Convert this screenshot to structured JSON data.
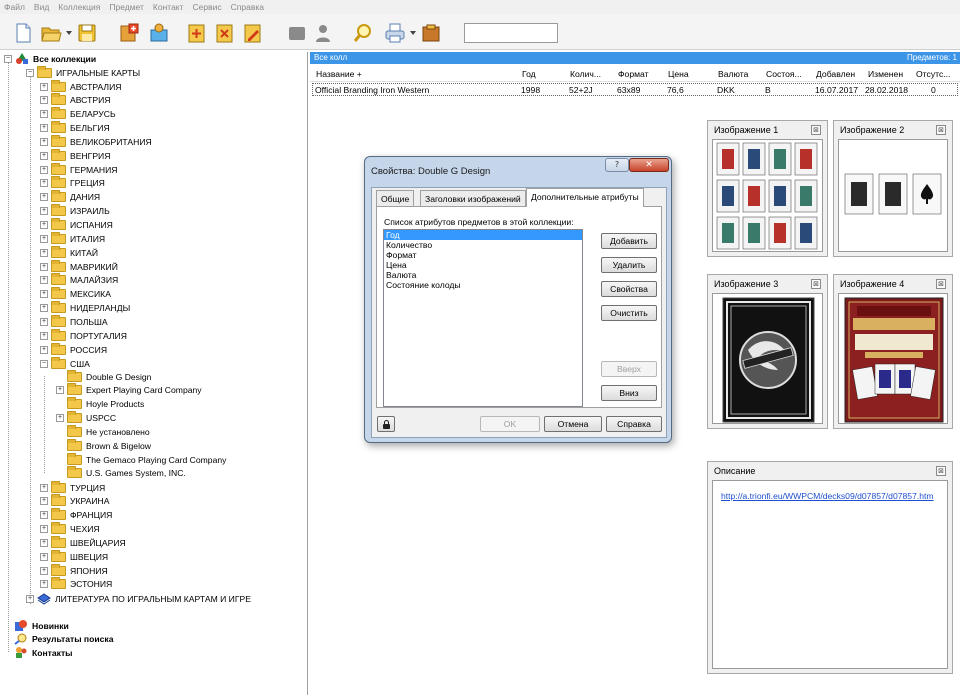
{
  "menu": [
    "Файл",
    "Вид",
    "Коллекция",
    "Предмет",
    "Контакт",
    "Сервис",
    "Справка"
  ],
  "toolbar": {
    "icons": [
      "new-document-icon",
      "open-folder-icon",
      "save-disk-icon",
      "collection-add-icon",
      "collection-edit-icon",
      "item-add-icon",
      "item-delete-icon",
      "item-edit-icon",
      "contact-icon",
      "person-icon",
      "search-icon",
      "print-icon",
      "export-icon"
    ],
    "search_value": ""
  },
  "tree": {
    "root": "Все коллекции",
    "playing_cards": "ИГРАЛЬНЫЕ КАРТЫ",
    "countries": [
      "АВСТРАЛИЯ",
      "АВСТРИЯ",
      "БЕЛАРУСЬ",
      "БЕЛЬГИЯ",
      "ВЕЛИКОБРИТАНИЯ",
      "ВЕНГРИЯ",
      "ГЕРМАНИЯ",
      "ГРЕЦИЯ",
      "ДАНИЯ",
      "ИЗРАИЛЬ",
      "ИСПАНИЯ",
      "ИТАЛИЯ",
      "КИТАЙ",
      "МАВРИКИЙ",
      "МАЛАЙЗИЯ",
      "МЕКСИКА",
      "НИДЕРЛАНДЫ",
      "ПОЛЬША",
      "ПОРТУГАЛИЯ",
      "РОССИЯ",
      "США"
    ],
    "usa_children": [
      "Double G Design",
      "Expert Playing Card Company",
      "Hoyle Products",
      "USPCC",
      "Не установлено",
      "Brown & Bigelow",
      "The Gemaco Playing Card Company",
      "U.S. Games System, INC."
    ],
    "countries_after": [
      "ТУРЦИЯ",
      "УКРАИНА",
      "ФРАНЦИЯ",
      "ЧЕХИЯ",
      "ШВЕЙЦАРИЯ",
      "ШВЕЦИЯ",
      "ЯПОНИЯ",
      "ЭСТОНИЯ"
    ],
    "literature": "ЛИТЕРАТУРА ПО ИГРАЛЬНЫМ КАРТАМ И ИГРЕ",
    "bottom": [
      "Новинки",
      "Результаты поиска",
      "Контакты"
    ]
  },
  "list": {
    "header_left": "Все колл",
    "header_right": "Предметов: 1",
    "columns": [
      "Название +",
      "Год",
      "Колич...",
      "Формат",
      "Цена",
      "Валюта",
      "Состоя...",
      "Добавлен",
      "Изменен",
      "Отсутс..."
    ],
    "row": [
      "Official Branding Iron Western",
      "1998",
      "52+2J",
      "63x89",
      "76,6",
      "DKK",
      "B",
      "16.07.2017",
      "28.02.2018",
      "0"
    ]
  },
  "images": {
    "title1": "Изображение 1",
    "title2": "Изображение 2",
    "title3": "Изображение 3",
    "title4": "Изображение 4",
    "close": "⊠"
  },
  "description": {
    "title": "Описание",
    "link": "http://a.trionfi.eu/WWPCM/decks09/d07857/d07857.htm"
  },
  "dialog": {
    "title": "Свойства: Double G Design",
    "help": "?",
    "close": "✕",
    "tabs": [
      "Общие",
      "Заголовки изображений",
      "Дополнительные атрибуты"
    ],
    "list_label": "Список атрибутов предметов в этой коллекции:",
    "attributes": [
      "Год",
      "Количество",
      "Формат",
      "Цена",
      "Валюта",
      "Состояние колоды"
    ],
    "buttons": {
      "add": "Добавить",
      "remove": "Удалить",
      "properties": "Свойства",
      "clear": "Очистить",
      "up": "Вверх",
      "down": "Вниз",
      "ok": "OK",
      "cancel": "Отмена",
      "help": "Справка"
    }
  },
  "colors": {
    "accent": "#3d95e8",
    "folder": "#f2c74a",
    "dialog_frame": "#c5d6ea",
    "close_button": "#c8432a",
    "selection": "#3399ff"
  }
}
